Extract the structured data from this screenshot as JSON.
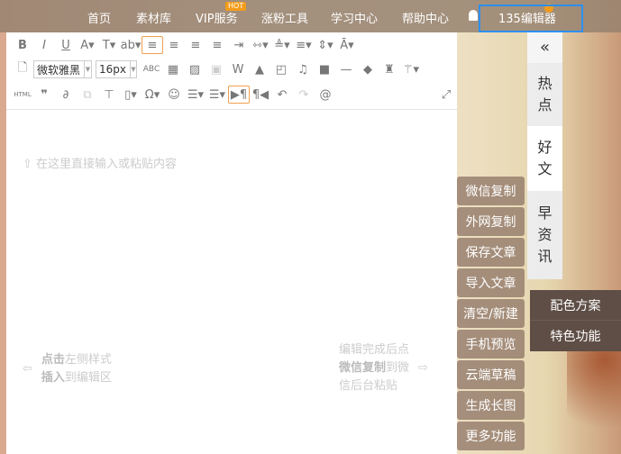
{
  "nav": {
    "items": [
      "首页",
      "素材库",
      "VIP服务",
      "涨粉工具",
      "学习中心",
      "帮助中心"
    ],
    "hot_badge": "HOT",
    "editor_link": "135编辑器"
  },
  "toolbar": {
    "font_family": "微软雅黑",
    "font_size": "16px",
    "html_label": "HTML"
  },
  "hints": {
    "top": "在这里直接输入或粘贴内容",
    "left_bold1": "点击",
    "left1": "左侧样式",
    "left_bold2": "插入",
    "left2": "到编辑区",
    "right1": "编辑完成后点",
    "right_bold": "微信复制",
    "right2": "到微",
    "right3": "信后台粘贴"
  },
  "actions": [
    "微信复制",
    "外网复制",
    "保存文章",
    "导入文章",
    "清空/新建",
    "手机预览",
    "云端草稿",
    "生成长图",
    "更多功能"
  ],
  "side_tabs": {
    "collapse": "«",
    "tabs": [
      [
        "热",
        "点"
      ],
      [
        "好",
        "文"
      ],
      [
        "早",
        "资",
        "讯"
      ]
    ]
  },
  "popup": [
    "配色方案",
    "特色功能"
  ],
  "colors": {
    "highlight": "#2e8ff0",
    "hot": "#f39c1a",
    "active_border": "#f0a050"
  }
}
